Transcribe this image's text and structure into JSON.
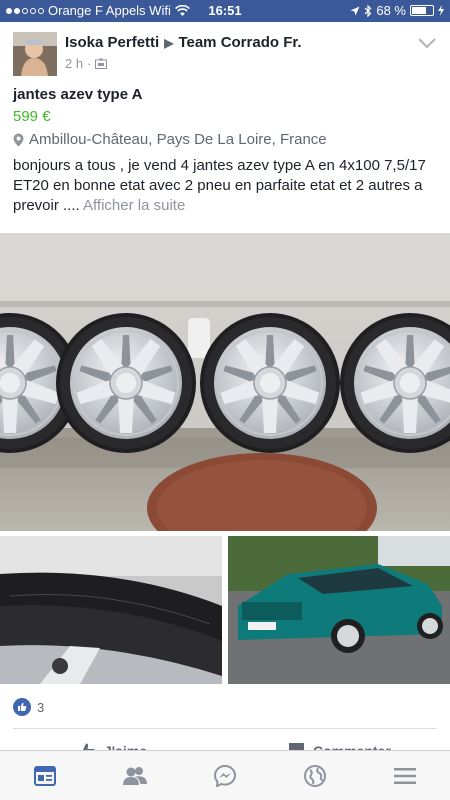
{
  "status_bar": {
    "carrier": "Orange F Appels Wifi",
    "time": "16:51",
    "battery": "68 %",
    "battery_level": 0.68
  },
  "post": {
    "author": "Isoka Perfetti",
    "group": "Team Corrado Fr.",
    "time_ago": "2 h",
    "title": "jantes azev type A",
    "price": "599 €",
    "location": "Ambillou-Château, Pays De La Loire, France",
    "body": "bonjours a tous , je vend 4 jantes azev type A en 4x100 7,5/17 ET20 en bonne etat avec 2 pneu en parfaite etat et 2 autres a prevoir ....",
    "see_more": "Afficher la suite",
    "like_count": "3"
  },
  "actions": {
    "like_label": "J'aime",
    "comment_label": "Commenter"
  },
  "tabs": [
    "news-feed-icon",
    "friends-icon",
    "messenger-icon",
    "globe-icon",
    "menu-icon"
  ],
  "colors": {
    "status_bar": "#3b5998",
    "price": "#42b72a",
    "active_tab": "#4267b2",
    "inactive_tab": "#8d949e"
  }
}
